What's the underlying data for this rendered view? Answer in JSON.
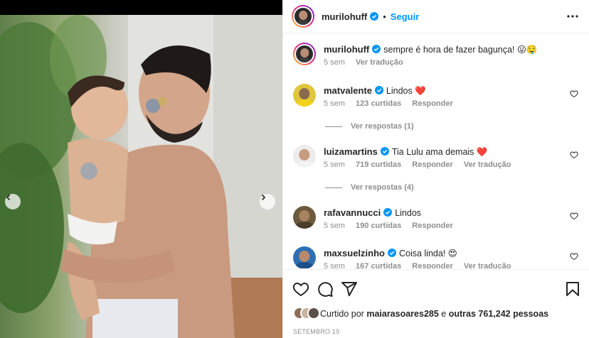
{
  "post": {
    "username": "murilohuff",
    "follow_label": "Seguir",
    "separator": "•",
    "caption": "sempre é hora de fazer bagunça! 😛🤤",
    "caption_time": "5 sem",
    "caption_translate": "Ver tradução",
    "verified_color": "#0095f6",
    "accent_color": "#0095f6"
  },
  "comments": [
    {
      "username": "matvalente",
      "text": "Lindos ❤️",
      "time": "5 sem",
      "likes": "123 curtidas",
      "reply": "Responder",
      "translate": "",
      "view_replies": "Ver respostas (1)"
    },
    {
      "username": "luizamartins",
      "text": "Tia Lulu ama demais ❤️",
      "time": "5 sem",
      "likes": "719 curtidas",
      "reply": "Responder",
      "translate": "Ver tradução",
      "view_replies": "Ver respostas (4)"
    },
    {
      "username": "rafavannucci",
      "text": "Lindos",
      "time": "5 sem",
      "likes": "190 curtidas",
      "reply": "Responder",
      "translate": "",
      "view_replies": ""
    },
    {
      "username": "maxsuelzinho",
      "text": "Coisa linda! 😍",
      "time": "5 sem",
      "likes": "167 curtidas",
      "reply": "Responder",
      "translate": "Ver tradução",
      "view_replies": ""
    }
  ],
  "likes_bar": {
    "prefix": "Curtido por",
    "liker": "maiarasoares285",
    "connector": "e",
    "others": "outras 761,242 pessoas"
  },
  "date": "SETEMBRO 19",
  "icons": {
    "more": "more-options-icon",
    "like": "heart-icon",
    "comment": "comment-icon",
    "share": "share-icon",
    "save": "bookmark-icon",
    "prev": "chevron-left-icon",
    "next": "chevron-right-icon"
  }
}
